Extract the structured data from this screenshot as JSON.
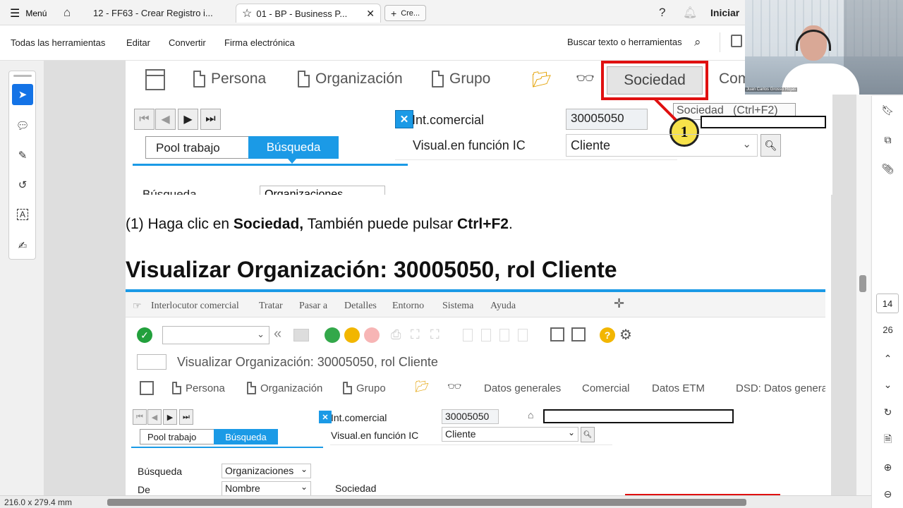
{
  "browser": {
    "menu_label": "Menú",
    "tabs": [
      {
        "label": "12 - FF63 - Crear Registro i..."
      },
      {
        "label": "01 - BP - Business P..."
      },
      {
        "label": "Cre..."
      }
    ],
    "signin_label": "Iniciar"
  },
  "acrobat": {
    "menu": [
      "Todas las herramientas",
      "Editar",
      "Convertir",
      "Firma electrónica"
    ],
    "search_label": "Buscar texto o herramientas",
    "page_numbers": [
      "14",
      "26"
    ],
    "page_size": "216.0 x 279.4 mm"
  },
  "sap_image_1": {
    "nav": [
      "Persona",
      "Organización",
      "Grupo"
    ],
    "highlight_button": "Sociedad",
    "cut_label": "Com",
    "tooltip": "Sociedad   (Ctrl+F2)",
    "callout_number": "1",
    "tabs": [
      "Pool trabajo",
      "Búsqueda"
    ],
    "fields": [
      {
        "label": "Int.comercial",
        "value": "30005050"
      },
      {
        "label": "Visual.en función IC",
        "value": "Cliente"
      }
    ],
    "partial_label": "Búsqueda",
    "partial_value": "Organizaciones"
  },
  "instruction": {
    "prefix": "(1) Haga clic en ",
    "bold1": "Sociedad,",
    "middle": " También puede pulsar ",
    "bold2": "Ctrl+F2",
    "suffix": "."
  },
  "heading": "Visualizar Organización: 30005050, rol Cliente",
  "sap_image_2": {
    "menu": [
      "Interlocutor comercial",
      "Tratar",
      "Pasar a",
      "Detalles",
      "Entorno",
      "Sistema",
      "Ayuda"
    ],
    "title": "Visualizar Organización: 30005050, rol Cliente",
    "nav": [
      "Persona",
      "Organización",
      "Grupo",
      "Datos generales",
      "Comercial",
      "Datos ETM",
      "DSD: Datos genera"
    ],
    "tabs": [
      "Pool trabajo",
      "Búsqueda"
    ],
    "fields": [
      {
        "label": "Int.comercial",
        "value": "30005050"
      },
      {
        "label": "Visual.en función IC",
        "value": "Cliente"
      }
    ],
    "search_rows": [
      {
        "label": "Búsqueda",
        "value": "Organizaciones"
      },
      {
        "label": "De",
        "value": "Nombre"
      }
    ],
    "sociedad_tab": "Sociedad"
  },
  "webcam": {
    "name_tag": "Juan Carlos Grosso Rojas"
  },
  "colors": {
    "sap_blue": "#1b9ae6",
    "highlight_red": "#e01010",
    "callout_yellow": "#f7e24a"
  }
}
